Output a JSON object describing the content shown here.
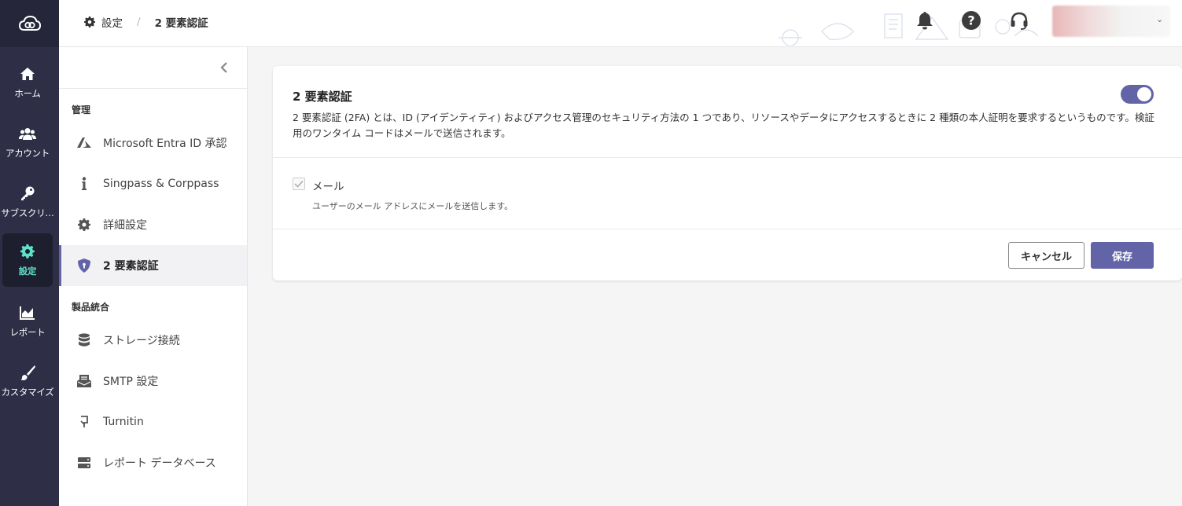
{
  "rail": {
    "items": [
      {
        "label": "ホーム",
        "icon": "home-icon"
      },
      {
        "label": "アカウント",
        "icon": "users-icon"
      },
      {
        "label": "サブスクリ…",
        "icon": "key-icon"
      },
      {
        "label": "設定",
        "icon": "gear-icon"
      },
      {
        "label": "レポート",
        "icon": "chart-icon"
      },
      {
        "label": "カスタマイズ",
        "icon": "brush-icon"
      }
    ],
    "active": "設定"
  },
  "breadcrumb": {
    "root": "設定",
    "separator": "/",
    "current": "2 要素認証"
  },
  "subnav": {
    "section_admin": "管理",
    "section_integration": "製品統合",
    "items": [
      {
        "label": "Microsoft Entra ID 承認",
        "icon": "azure-icon"
      },
      {
        "label": "Singpass & Corppass",
        "icon": "info-icon"
      },
      {
        "label": "詳細設定",
        "icon": "gear-icon"
      },
      {
        "label": "2 要素認証",
        "icon": "shield-icon"
      },
      {
        "label": "ストレージ接続",
        "icon": "database-icon"
      },
      {
        "label": "SMTP 設定",
        "icon": "mail-icon"
      },
      {
        "label": "Turnitin",
        "icon": "turnitin-icon"
      },
      {
        "label": "レポート データベース",
        "icon": "server-icon"
      }
    ]
  },
  "card": {
    "title": "2 要素認証",
    "description": "2 要素認証 (2FA) とは、ID (アイデンティティ) およびアクセス管理のセキュリティ方法の 1 つであり、リソースやデータにアクセスするときに 2 種類の本人証明を要求するというものです。検証用のワンタイム コードはメールで送信されます。",
    "toggle_on": true,
    "option_label": "メール",
    "option_help": "ユーザーのメール アドレスにメールを送信します。",
    "option_checked": true,
    "cancel_label": "キャンセル",
    "save_label": "保存"
  },
  "colors": {
    "accent": "#6264a7",
    "rail_bg": "#2e2f47",
    "rail_active_text": "#5fe0c8"
  }
}
